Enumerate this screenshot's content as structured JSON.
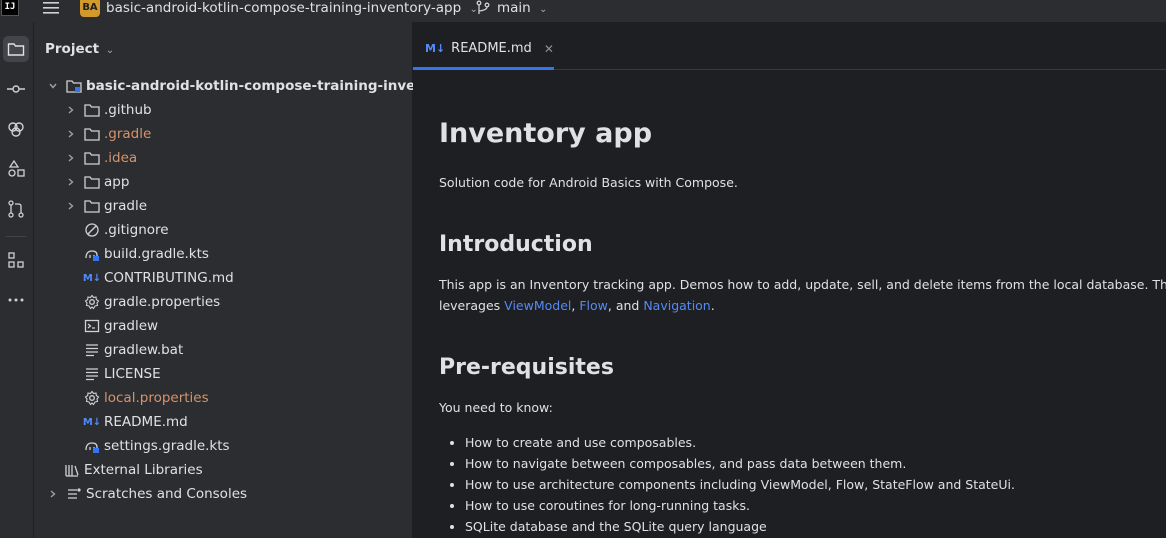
{
  "titlebar": {
    "app_logo": "IJ",
    "project_badge": "BA",
    "project_name": "basic-android-kotlin-compose-training-inventory-app",
    "branch": "main"
  },
  "project_panel": {
    "title": "Project",
    "root": "basic-android-kotlin-compose-training-inventory-ap",
    "items": [
      {
        "label": ".github",
        "type": "folder"
      },
      {
        "label": ".gradle",
        "type": "folder",
        "color": "#d6936c"
      },
      {
        "label": ".idea",
        "type": "folder",
        "color": "#d6936c"
      },
      {
        "label": "app",
        "type": "folder"
      },
      {
        "label": "gradle",
        "type": "folder"
      },
      {
        "label": ".gitignore",
        "type": "ignore"
      },
      {
        "label": "build.gradle.kts",
        "type": "gradle"
      },
      {
        "label": "CONTRIBUTING.md",
        "type": "md"
      },
      {
        "label": "gradle.properties",
        "type": "settings"
      },
      {
        "label": "gradlew",
        "type": "terminal"
      },
      {
        "label": "gradlew.bat",
        "type": "text"
      },
      {
        "label": "LICENSE",
        "type": "text"
      },
      {
        "label": "local.properties",
        "type": "settings",
        "color": "#d6936c"
      },
      {
        "label": "README.md",
        "type": "md"
      },
      {
        "label": "settings.gradle.kts",
        "type": "gradle"
      }
    ],
    "external_libraries": "External Libraries",
    "scratches": "Scratches and Consoles"
  },
  "editor": {
    "tab_label": "README.md",
    "md_glyph": "M↓"
  },
  "doc": {
    "title": "Inventory app",
    "subtitle": "Solution code for Android Basics with Compose.",
    "intro_heading": "Introduction",
    "intro_text": "This app is an Inventory tracking app. Demos how to add, update, sell, and delete items from the local database. This app dem",
    "leverages_prefix": "leverages ",
    "link_viewmodel": "ViewModel",
    "sep1": ", ",
    "link_flow": "Flow",
    "sep2": ", and ",
    "link_navigation": "Navigation",
    "end": ".",
    "prereq_heading": "Pre-requisites",
    "prereq_text": "You need to know:",
    "bullets": [
      "How to create and use composables.",
      "How to navigate between composables, and pass data between them.",
      "How to use architecture components including ViewModel, Flow, StateFlow and StateUi.",
      "How to use coroutines for long-running tasks.",
      "SQLite database and the SQLite query language"
    ]
  }
}
